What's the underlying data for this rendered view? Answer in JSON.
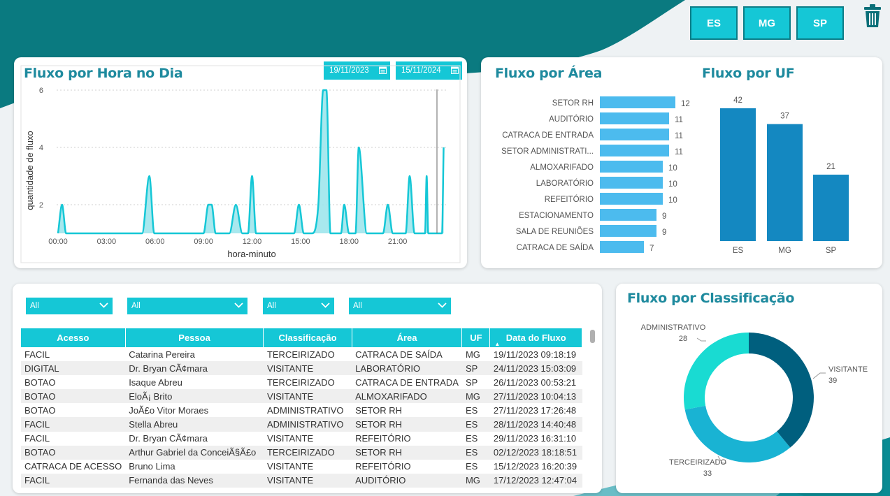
{
  "uf_buttons": [
    {
      "label": "ES"
    },
    {
      "label": "MG"
    },
    {
      "label": "SP"
    }
  ],
  "colors": {
    "teal_dark": "#0a7a80",
    "accent": "#15c7d6",
    "bar_area": "#4cbbee",
    "bar_uf": "#1488c1",
    "donut_visitante": "#005f7e",
    "donut_terceirizado": "#19b3d3",
    "donut_administrativo": "#19dbd2"
  },
  "hourly": {
    "title": "Fluxo por Hora no Dia",
    "date_start": "19/11/2023",
    "date_end": "15/11/2024",
    "chart_data": {
      "type": "area",
      "title": "Fluxo por Hora no Dia",
      "xlabel": "hora-minuto",
      "ylabel": "quantidade de fluxo",
      "x_ticks": [
        "00:00",
        "03:00",
        "06:00",
        "09:00",
        "12:00",
        "15:00",
        "18:00",
        "21:00"
      ],
      "y_ticks": [
        "2",
        "4",
        "6"
      ],
      "xlim": [
        0,
        24
      ],
      "ylim": [
        1,
        6
      ],
      "grid": true,
      "x": [
        0.0,
        0.25,
        0.5,
        5.2,
        5.65,
        5.95,
        9.0,
        9.3,
        9.5,
        9.75,
        10.0,
        10.6,
        11.0,
        11.4,
        11.75,
        12.0,
        12.25,
        14.6,
        14.9,
        15.2,
        15.7,
        16.1,
        16.4,
        16.6,
        16.85,
        17.3,
        17.5,
        17.7,
        18.0,
        18.2,
        18.4,
        18.6,
        19.1,
        19.4,
        20.1,
        20.4,
        20.7,
        21.0,
        21.5,
        21.75,
        22.05,
        22.2,
        22.35,
        22.55,
        22.7,
        22.8,
        22.9,
        23.1,
        23.25,
        23.35,
        23.45,
        23.55,
        23.65,
        23.75,
        23.85
      ],
      "y": [
        1,
        2,
        1,
        1,
        3,
        1,
        1,
        2,
        2,
        1,
        1,
        1,
        2,
        1,
        1,
        3,
        1,
        1,
        2,
        1,
        1,
        2,
        6,
        6,
        1,
        1,
        1,
        2,
        1,
        1,
        1,
        4,
        1,
        1,
        1,
        2,
        1,
        1,
        1,
        3,
        1,
        1,
        1,
        1,
        1,
        3,
        1,
        1,
        1,
        1,
        1,
        1,
        1,
        1,
        4
      ]
    }
  },
  "area": {
    "title": "Fluxo por Área",
    "chart_data": {
      "type": "bar",
      "orientation": "horizontal",
      "title": "Fluxo por Área",
      "categories": [
        "SETOR RH",
        "AUDITÓRIO",
        "CATRACA DE ENTRADA",
        "SETOR ADMINISTRATI...",
        "ALMOXARIFADO",
        "LABORATÓRIO",
        "REFEITÓRIO",
        "ESTACIONAMENTO",
        "SALA DE REUNIÕES",
        "CATRACA DE SAÍDA"
      ],
      "values": [
        12,
        11,
        11,
        11,
        10,
        10,
        10,
        9,
        9,
        7
      ]
    }
  },
  "uf": {
    "title": "Fluxo por UF",
    "chart_data": {
      "type": "bar",
      "title": "Fluxo por UF",
      "categories": [
        "ES",
        "MG",
        "SP"
      ],
      "values": [
        42,
        37,
        21
      ],
      "ylim": [
        0,
        42
      ]
    }
  },
  "classificacao": {
    "title": "Fluxo por Classificação",
    "chart_data": {
      "type": "pie",
      "donut": true,
      "title": "Fluxo por Classificação",
      "categories": [
        "VISITANTE",
        "TERCEIRIZADO",
        "ADMINISTRATIVO"
      ],
      "values": [
        39,
        33,
        28
      ]
    }
  },
  "filters": [
    {
      "value": "All"
    },
    {
      "value": "All"
    },
    {
      "value": "All"
    },
    {
      "value": "All"
    }
  ],
  "table": {
    "columns": [
      "Acesso",
      "Pessoa",
      "Classificação",
      "Área",
      "UF",
      "Data do Fluxo"
    ],
    "rows": [
      [
        "FACIL",
        "Catarina Pereira",
        "TERCEIRIZADO",
        "CATRACA DE SAÍDA",
        "MG",
        "19/11/2023 09:18:19"
      ],
      [
        "DIGITAL",
        "Dr. Bryan CÃ¢mara",
        "VISITANTE",
        "LABORATÓRIO",
        "SP",
        "24/11/2023 15:03:09"
      ],
      [
        "BOTAO",
        "Isaque Abreu",
        "TERCEIRIZADO",
        "CATRACA DE ENTRADA",
        "SP",
        "26/11/2023 00:53:21"
      ],
      [
        "BOTAO",
        "EloÃ¡ Brito",
        "VISITANTE",
        "ALMOXARIFADO",
        "MG",
        "27/11/2023 10:04:13"
      ],
      [
        "BOTAO",
        "JoÃ£o Vitor Moraes",
        "ADMINISTRATIVO",
        "SETOR RH",
        "ES",
        "27/11/2023 17:26:48"
      ],
      [
        "FACIL",
        "Stella Abreu",
        "ADMINISTRATIVO",
        "SETOR RH",
        "ES",
        "28/11/2023 14:40:48"
      ],
      [
        "FACIL",
        "Dr. Bryan CÃ¢mara",
        "VISITANTE",
        "REFEITÓRIO",
        "ES",
        "29/11/2023 16:31:10"
      ],
      [
        "BOTAO",
        "Arthur Gabriel da ConceiÃ§Ã£o",
        "TERCEIRIZADO",
        "SETOR RH",
        "ES",
        "02/12/2023 18:18:51"
      ],
      [
        "CATRACA DE ACESSO",
        "Bruno Lima",
        "VISITANTE",
        "REFEITÓRIO",
        "ES",
        "15/12/2023 16:20:39"
      ],
      [
        "FACIL",
        "Fernanda das Neves",
        "VISITANTE",
        "AUDITÓRIO",
        "MG",
        "17/12/2023 12:47:04"
      ]
    ]
  }
}
